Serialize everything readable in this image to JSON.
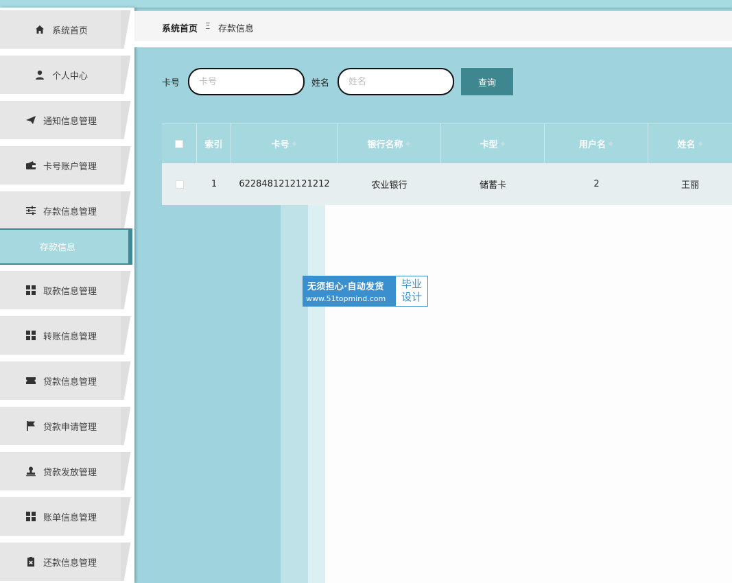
{
  "breadcrumb": {
    "home": "系统首页",
    "separator": "Ξ",
    "current": "存款信息"
  },
  "sidebar": {
    "items": [
      {
        "label": "系统首页",
        "icon": "home-icon"
      },
      {
        "label": "个人中心",
        "icon": "user-icon"
      },
      {
        "label": "通知信息管理",
        "icon": "paper-plane-icon"
      },
      {
        "label": "卡号账户管理",
        "icon": "wallet-icon"
      },
      {
        "label": "存款信息管理",
        "icon": "sliders-icon"
      },
      {
        "label": "取款信息管理",
        "icon": "grid-icon"
      },
      {
        "label": "转账信息管理",
        "icon": "grid-icon"
      },
      {
        "label": "贷款信息管理",
        "icon": "ticket-icon"
      },
      {
        "label": "贷款申请管理",
        "icon": "flag-icon"
      },
      {
        "label": "贷款发放管理",
        "icon": "stamp-icon"
      },
      {
        "label": "账单信息管理",
        "icon": "grid-icon"
      },
      {
        "label": "还款信息管理",
        "icon": "clipboard-x-icon"
      }
    ],
    "active_submenu": "存款信息"
  },
  "search": {
    "card_label": "卡号",
    "card_placeholder": "卡号",
    "card_value": "",
    "name_label": "姓名",
    "name_placeholder": "姓名",
    "name_value": "",
    "query_button": "查询"
  },
  "table": {
    "columns": [
      "",
      "索引",
      "卡号",
      "银行名称",
      "卡型",
      "用户名",
      "姓名"
    ],
    "rows": [
      {
        "index": "1",
        "card_no": "6228481212121212",
        "bank": "农业银行",
        "card_type": "储蓄卡",
        "username": "2",
        "name": "王丽"
      }
    ]
  },
  "watermark": {
    "line1": "无须担心·自动发货",
    "line2": "www.51topmind.com",
    "right1": "毕业",
    "right2": "设计"
  }
}
